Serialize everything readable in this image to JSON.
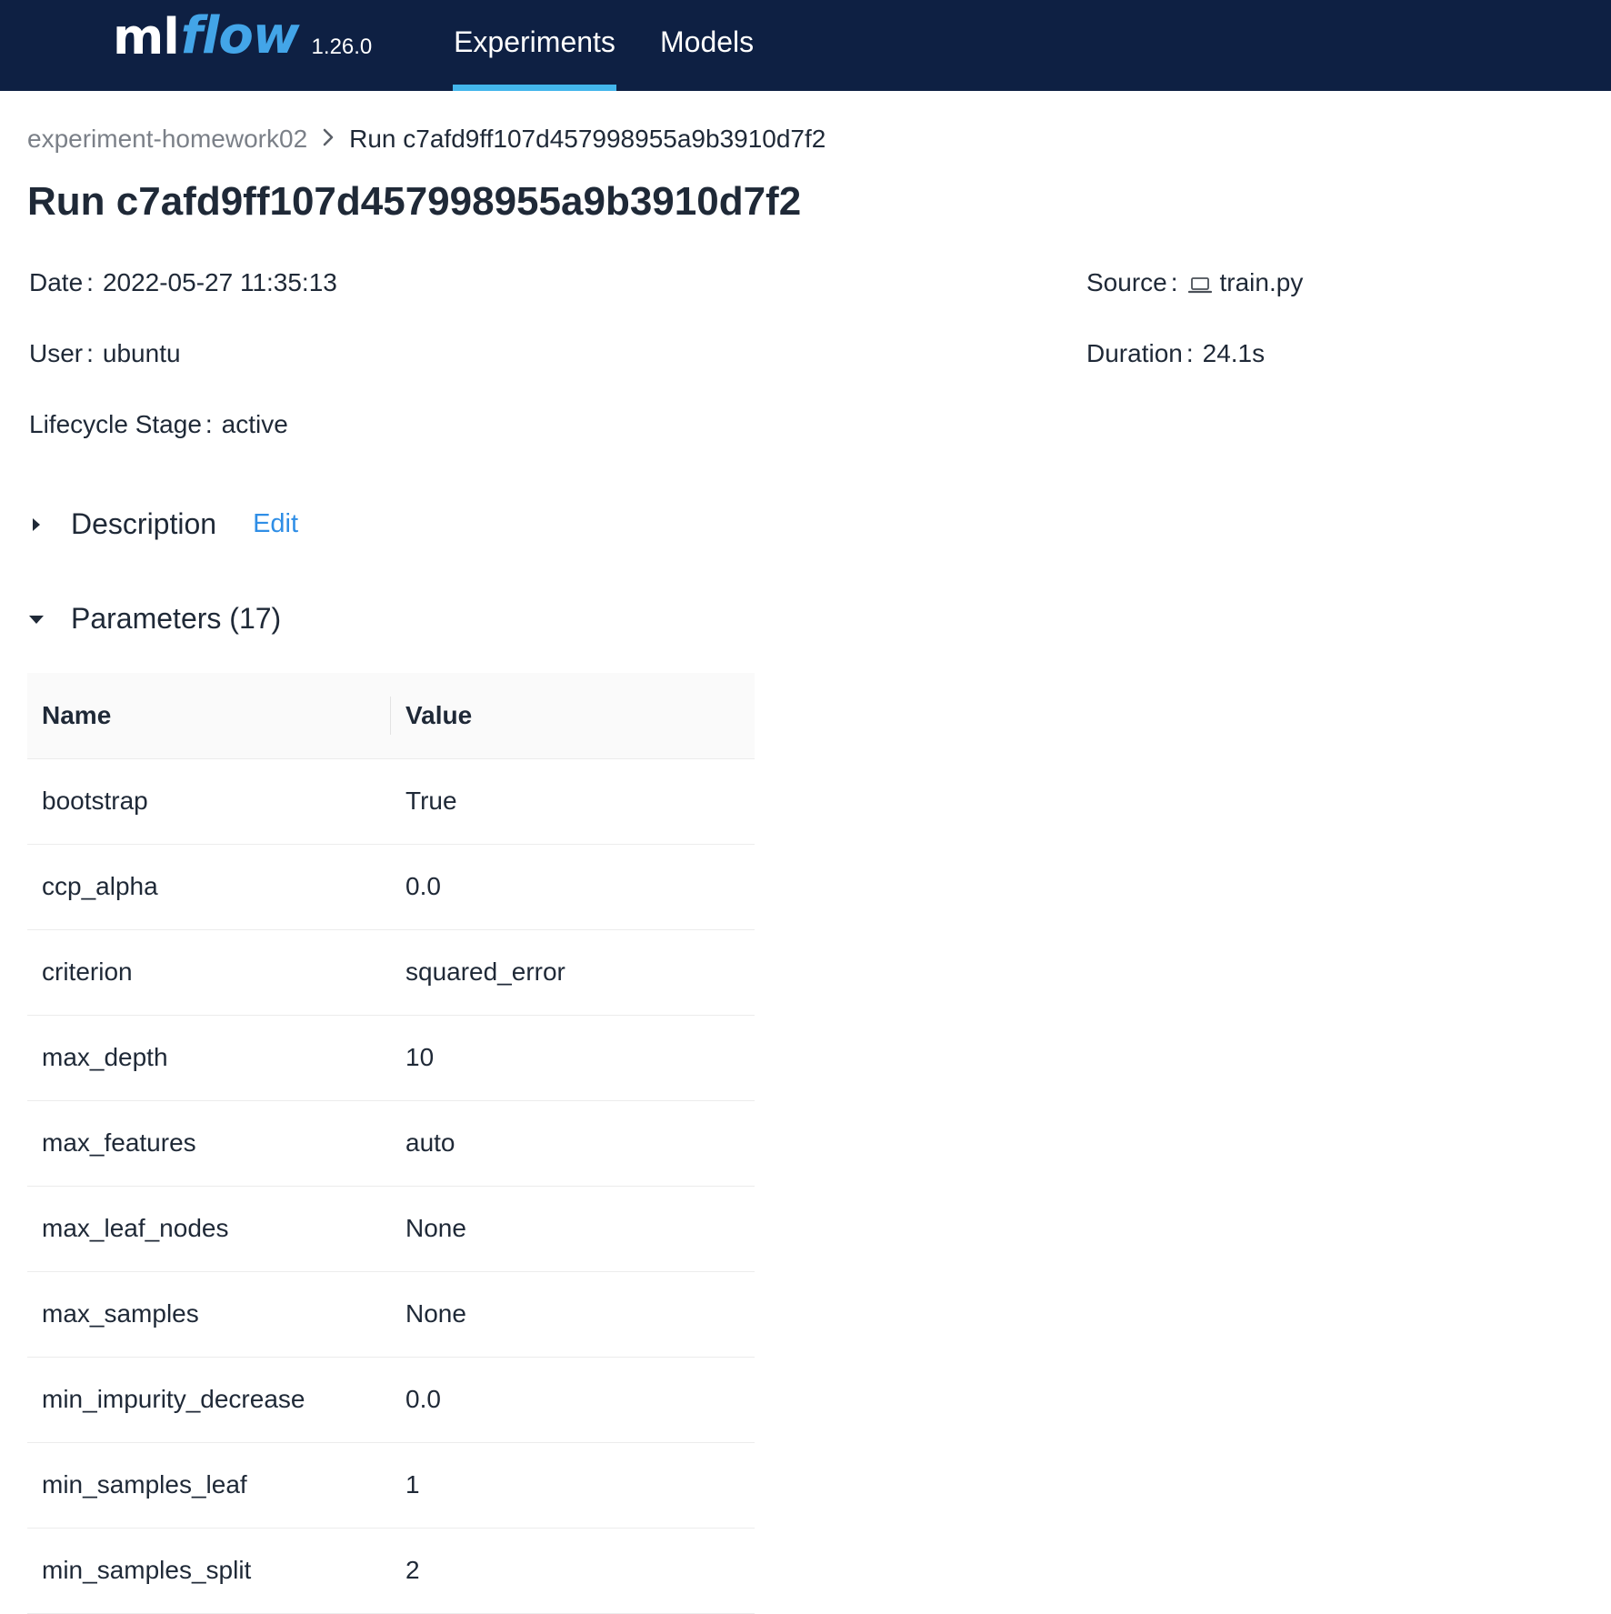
{
  "header": {
    "logo_ml": "ml",
    "logo_flow": "flow",
    "version": "1.26.0",
    "tabs": [
      {
        "label": "Experiments",
        "active": true
      },
      {
        "label": "Models",
        "active": false
      }
    ],
    "colors": {
      "background": "#0e2043",
      "accent": "#43b6ec",
      "logo_flow": "#43a5e8"
    }
  },
  "breadcrumb": {
    "experiment": "experiment-homework02",
    "separator_icon": "chevron-right-icon",
    "current": "Run c7afd9ff107d457998955a9b3910d7f2"
  },
  "title": "Run c7afd9ff107d457998955a9b3910d7f2",
  "meta": {
    "date": {
      "label": "Date",
      "value": "2022-05-27 11:35:13"
    },
    "user": {
      "label": "User",
      "value": "ubuntu"
    },
    "lifecycle_stage": {
      "label": "Lifecycle Stage",
      "value": "active"
    },
    "source": {
      "label": "Source",
      "icon": "laptop-icon",
      "value": "train.py"
    },
    "duration": {
      "label": "Duration",
      "value": "24.1s"
    }
  },
  "description": {
    "title": "Description",
    "edit_label": "Edit",
    "expanded": false
  },
  "parameters": {
    "title": "Parameters (17)",
    "expanded": true,
    "columns": [
      "Name",
      "Value"
    ],
    "rows": [
      {
        "name": "bootstrap",
        "value": "True"
      },
      {
        "name": "ccp_alpha",
        "value": "0.0"
      },
      {
        "name": "criterion",
        "value": "squared_error"
      },
      {
        "name": "max_depth",
        "value": "10"
      },
      {
        "name": "max_features",
        "value": "auto"
      },
      {
        "name": "max_leaf_nodes",
        "value": "None"
      },
      {
        "name": "max_samples",
        "value": "None"
      },
      {
        "name": "min_impurity_decrease",
        "value": "0.0"
      },
      {
        "name": "min_samples_leaf",
        "value": "1"
      },
      {
        "name": "min_samples_split",
        "value": "2"
      }
    ]
  }
}
